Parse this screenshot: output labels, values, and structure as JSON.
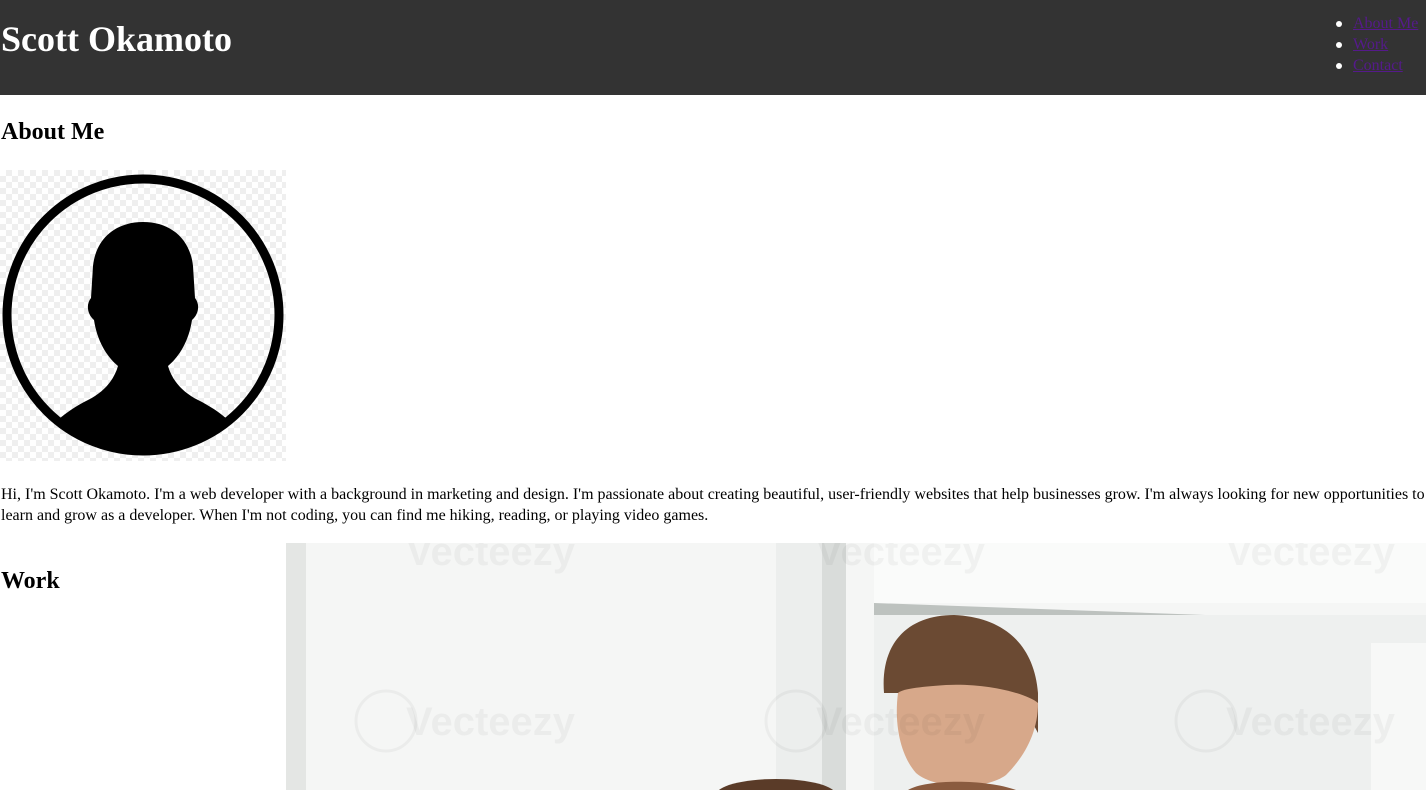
{
  "header": {
    "title": "Scott Okamoto",
    "nav": [
      {
        "label": "About Me"
      },
      {
        "label": "Work"
      },
      {
        "label": "Contact"
      }
    ]
  },
  "about": {
    "heading": "About Me",
    "avatar_icon": "person-silhouette-icon",
    "bio": "Hi, I'm Scott Okamoto. I'm a web developer with a background in marketing and design. I'm passionate about creating beautiful, user-friendly websites that help businesses grow. I'm always looking for new opportunities to learn and grow as a developer. When I'm not coding, you can find me hiking, reading, or playing video games."
  },
  "work": {
    "heading": "Work",
    "image_watermark": "Vecteezy"
  },
  "colors": {
    "header_bg": "#333333",
    "header_text": "#ffffff",
    "link_visited": "#551a8b"
  }
}
